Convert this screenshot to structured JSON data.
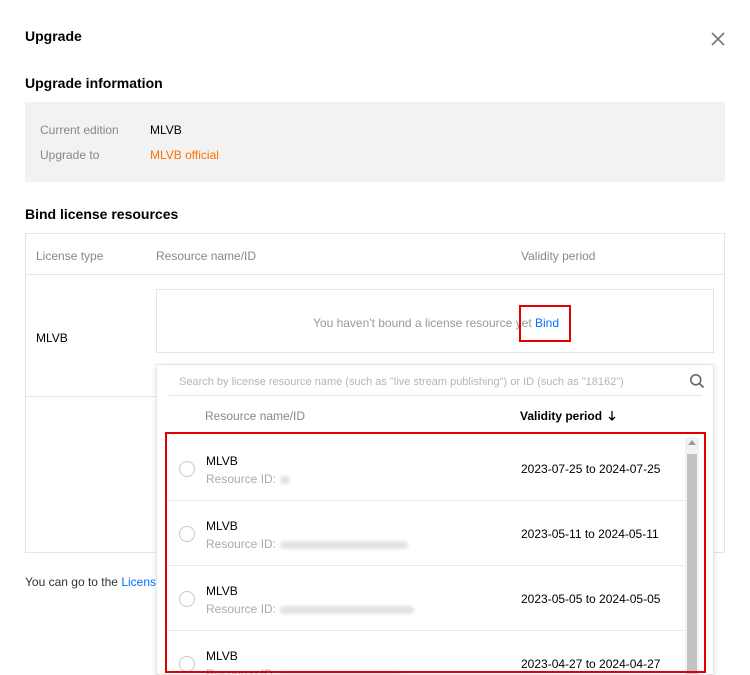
{
  "dialog": {
    "title": "Upgrade"
  },
  "upgrade_info": {
    "title": "Upgrade information",
    "current_edition_label": "Current edition",
    "current_edition_value": "MLVB",
    "upgrade_to_label": "Upgrade to",
    "upgrade_to_value": "MLVB official"
  },
  "bind": {
    "title": "Bind license resources",
    "columns": [
      "License type",
      "Resource name/ID",
      "Validity period"
    ],
    "row_license_type": "MLVB",
    "empty_text": "You haven't bound a license resource yet",
    "bind_link": "Bind"
  },
  "dropdown": {
    "search_placeholder": "Search by license resource name (such as \"live stream publishing\") or ID (such as \"18162\")",
    "col_name": "Resource name/ID",
    "col_validity": "Validity period",
    "id_label": "Resource ID:",
    "items": [
      {
        "name": "MLVB",
        "validity": "2023-07-25 to 2024-07-25"
      },
      {
        "name": "MLVB",
        "validity": "2023-05-11 to 2024-05-11"
      },
      {
        "name": "MLVB",
        "validity": "2023-05-05 to 2024-05-05"
      },
      {
        "name": "MLVB",
        "validity": "2023-04-27 to 2024-04-27"
      }
    ]
  },
  "footer": {
    "text": "You can go to the",
    "link": "Licens"
  },
  "colors": {
    "accent_orange": "#ff7200",
    "link_blue": "#006eff",
    "highlight_red": "#e00000"
  }
}
